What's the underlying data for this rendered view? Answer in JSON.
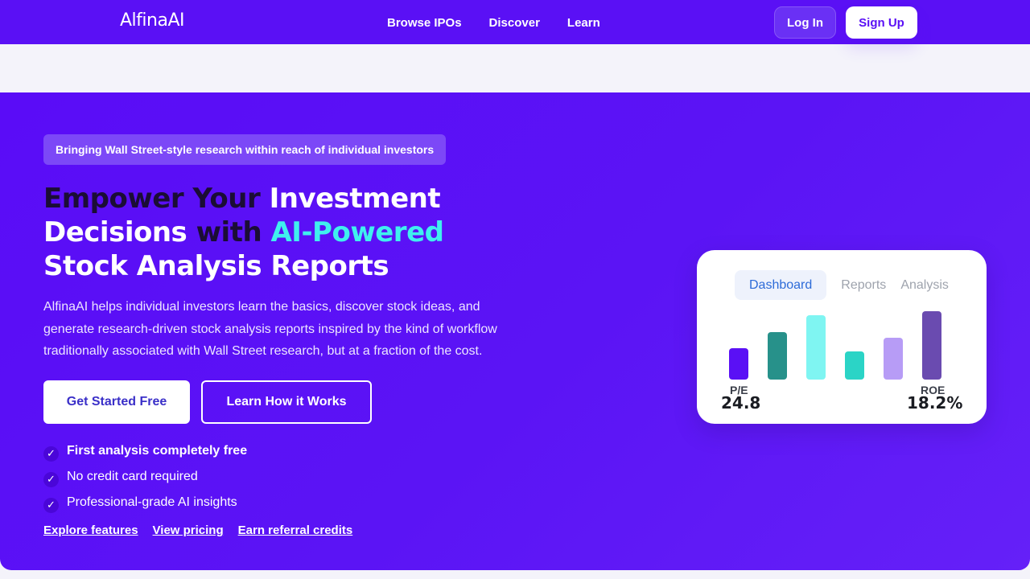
{
  "nav": {
    "logo": "AlfinaAI",
    "links": [
      "Browse IPOs",
      "Discover",
      "Learn"
    ],
    "login_label": "Log In",
    "signup_label": "Sign Up"
  },
  "hero": {
    "badge": "Bringing Wall Street-style research within reach of individual investors",
    "headline": {
      "part1": "Empower Your ",
      "part2": "Investment ",
      "part3": "Decisions ",
      "part4": "with ",
      "part5": "AI-Powered",
      "part6": "Stock Analysis Reports"
    },
    "description": "AlfinaAI helps individual investors learn the basics, discover stock ideas, and generate research-driven stock analysis reports inspired by the kind of workflow traditionally associated with Wall Street research, but at a fraction of the cost.",
    "cta_primary": "Get Started Free",
    "cta_secondary": "Learn How it Works",
    "checks": [
      "First analysis completely free",
      "No credit card required",
      "Professional-grade AI insights"
    ],
    "check_glyph": "✓",
    "links": [
      "Explore features",
      "View pricing",
      "Earn referral credits"
    ]
  },
  "card": {
    "tabs": [
      "Dashboard",
      "Reports",
      "Analysis"
    ],
    "active_tab": "Dashboard",
    "bars": [
      {
        "color": "#5a10f5",
        "level": 0.46
      },
      {
        "color": "#27918a",
        "level": 0.69
      },
      {
        "color": "#7ff5f2",
        "level": 0.94
      },
      {
        "color": "#2bd4c6",
        "level": 0.41
      },
      {
        "color": "#b79cf6",
        "level": 0.61
      },
      {
        "color": "#6a4bb0",
        "level": 1.0
      }
    ],
    "metrics": [
      {
        "label": "P/E",
        "value": "24.8"
      },
      {
        "label": "ROE",
        "value": "18.2%"
      }
    ]
  },
  "colors": {
    "brand": "#5a10f5",
    "accent_cyan": "#3ff0ee",
    "headline_dark": "#1b0d35",
    "primary_button_text": "#3a2fc8"
  }
}
